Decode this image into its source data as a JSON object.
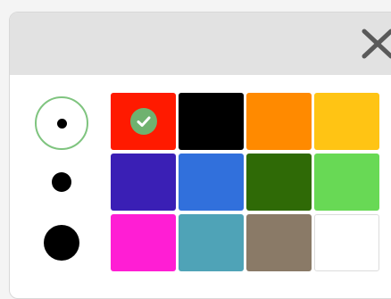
{
  "header": {
    "close_icon": "close-icon"
  },
  "brush_sizes": [
    {
      "name": "small",
      "selected": true
    },
    {
      "name": "medium",
      "selected": false
    },
    {
      "name": "large",
      "selected": false
    }
  ],
  "colors": {
    "rows": [
      [
        "#ff1a00",
        "#000000",
        "#ff8a00",
        "#ffc414"
      ],
      [
        "#3a1fb5",
        "#3170dc",
        "#2f6a06",
        "#68d955"
      ],
      [
        "#ff1ed4",
        "#4fa3b7",
        "#8a7a67",
        "#ffffff"
      ]
    ],
    "selected": "#ff1a00",
    "check_badge_color": "#6fb26f",
    "selected_icon": "check-icon"
  },
  "accent": "#7fc47f"
}
